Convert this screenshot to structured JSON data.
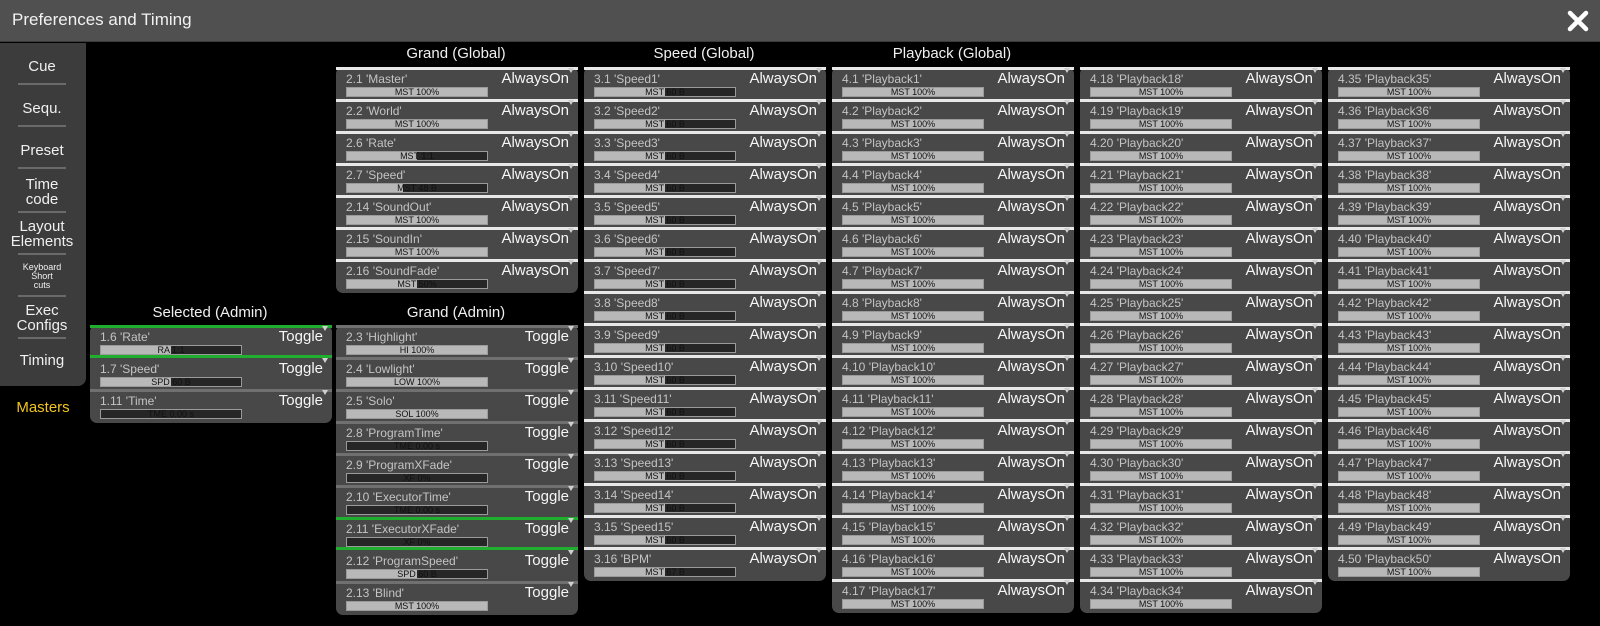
{
  "window": {
    "title": "Preferences and Timing",
    "close_icon": "close-icon"
  },
  "sidebar": {
    "items": [
      {
        "id": "cue",
        "label": "Cue"
      },
      {
        "id": "sequ",
        "label": "Sequ."
      },
      {
        "id": "preset",
        "label": "Preset"
      },
      {
        "id": "timecode",
        "label": "Time\ncode"
      },
      {
        "id": "layout-elements",
        "label": "Layout\nElements"
      },
      {
        "id": "keyboard-shortcuts",
        "label": "Keyboard\nShort\ncuts"
      },
      {
        "id": "exec-configs",
        "label": "Exec\nConfigs"
      },
      {
        "id": "timing",
        "label": "Timing"
      }
    ],
    "masters_label": "Masters",
    "masters_color": "#f2c51e"
  },
  "colors": {
    "panel": "#484848",
    "separator": "#e8e8e8",
    "active": "#1fae2d",
    "accent": "#f2c51e"
  },
  "groups": [
    {
      "id": "selected-admin",
      "title": "Selected (Admin)",
      "rows": [
        {
          "name": "1.6 'Rate'",
          "bar": "RA 1:1",
          "fill": 0.5,
          "value": "Toggle",
          "sep": "green",
          "active": true
        },
        {
          "name": "1.7 'Speed'",
          "bar": "SPD 60 B",
          "fill": 0.5,
          "value": "Toggle",
          "sep": "none"
        },
        {
          "name": "1.11 'Time'",
          "bar": "TME 0.00 s",
          "fill": 0.0,
          "value": "Toggle",
          "sep": "grey"
        }
      ]
    },
    {
      "id": "grand-global",
      "title": "Grand (Global)",
      "rows": [
        {
          "name": "2.1 'Master'",
          "bar": "MST 100%",
          "fill": 1.0,
          "value": "AlwaysOn",
          "sep": "white"
        },
        {
          "name": "2.2 'World'",
          "bar": "MST 100%",
          "fill": 1.0,
          "value": "AlwaysOn",
          "sep": "white"
        },
        {
          "name": "2.6 'Rate'",
          "bar": "MST 1:1",
          "fill": 0.5,
          "value": "AlwaysOn",
          "sep": "white"
        },
        {
          "name": "2.7 'Speed'",
          "bar": "MST 48 B",
          "fill": 0.4,
          "value": "AlwaysOn",
          "sep": "white"
        },
        {
          "name": "2.14 'SoundOut'",
          "bar": "MST 100%",
          "fill": 1.0,
          "value": "AlwaysOn",
          "sep": "white"
        },
        {
          "name": "2.15 'SoundIn'",
          "bar": "MST 100%",
          "fill": 1.0,
          "value": "AlwaysOn",
          "sep": "white"
        },
        {
          "name": "2.16 'SoundFade'",
          "bar": "MST 50%",
          "fill": 0.5,
          "value": "AlwaysOn",
          "sep": "white"
        }
      ]
    },
    {
      "id": "grand-admin",
      "title": "Grand (Admin)",
      "rows": [
        {
          "name": "2.3 'Highlight'",
          "bar": "HI 100%",
          "fill": 1.0,
          "value": "Toggle",
          "sep": "grey"
        },
        {
          "name": "2.4 'Lowlight'",
          "bar": "LOW 100%",
          "fill": 1.0,
          "value": "Toggle",
          "sep": "grey"
        },
        {
          "name": "2.5 'Solo'",
          "bar": "SOL 100%",
          "fill": 1.0,
          "value": "Toggle",
          "sep": "grey"
        },
        {
          "name": "2.8 'ProgramTime'",
          "bar": "TME 0.00 s",
          "fill": 0.0,
          "value": "Toggle",
          "sep": "grey"
        },
        {
          "name": "2.9 'ProgramXFade'",
          "bar": "XF 0%",
          "fill": 0.0,
          "value": "Toggle",
          "sep": "grey"
        },
        {
          "name": "2.10 'ExecutorTime'",
          "bar": "TME 0.00 s",
          "fill": 0.0,
          "value": "Toggle",
          "sep": "grey"
        },
        {
          "name": "2.11 'ExecutorXFade'",
          "bar": "XF 0%",
          "fill": 0.0,
          "value": "Toggle",
          "sep": "green",
          "active": true
        },
        {
          "name": "2.12 'ProgramSpeed'",
          "bar": "SPD 60 B",
          "fill": 0.5,
          "value": "Toggle",
          "sep": "none"
        },
        {
          "name": "2.13 'Blind'",
          "bar": "MST 100%",
          "fill": 1.0,
          "value": "Toggle",
          "sep": "grey"
        }
      ]
    },
    {
      "id": "speed-global",
      "title": "Speed (Global)",
      "rows": [
        {
          "name": "3.1 'Speed1'",
          "bar": "MST 60 B",
          "fill": 0.5,
          "value": "AlwaysOn",
          "sep": "white"
        },
        {
          "name": "3.2 'Speed2'",
          "bar": "MST 60 B",
          "fill": 0.5,
          "value": "AlwaysOn",
          "sep": "white"
        },
        {
          "name": "3.3 'Speed3'",
          "bar": "MST 60 B",
          "fill": 0.5,
          "value": "AlwaysOn",
          "sep": "white"
        },
        {
          "name": "3.4 'Speed4'",
          "bar": "MST 60 B",
          "fill": 0.5,
          "value": "AlwaysOn",
          "sep": "white"
        },
        {
          "name": "3.5 'Speed5'",
          "bar": "MST 60 B",
          "fill": 0.5,
          "value": "AlwaysOn",
          "sep": "white"
        },
        {
          "name": "3.6 'Speed6'",
          "bar": "MST 60 B",
          "fill": 0.5,
          "value": "AlwaysOn",
          "sep": "white"
        },
        {
          "name": "3.7 'Speed7'",
          "bar": "MST 60 B",
          "fill": 0.5,
          "value": "AlwaysOn",
          "sep": "white"
        },
        {
          "name": "3.8 'Speed8'",
          "bar": "MST 60 B",
          "fill": 0.5,
          "value": "AlwaysOn",
          "sep": "white"
        },
        {
          "name": "3.9 'Speed9'",
          "bar": "MST 60 B",
          "fill": 0.5,
          "value": "AlwaysOn",
          "sep": "white"
        },
        {
          "name": "3.10 'Speed10'",
          "bar": "MST 60 B",
          "fill": 0.5,
          "value": "AlwaysOn",
          "sep": "white"
        },
        {
          "name": "3.11 'Speed11'",
          "bar": "MST 60 B",
          "fill": 0.5,
          "value": "AlwaysOn",
          "sep": "white"
        },
        {
          "name": "3.12 'Speed12'",
          "bar": "MST 60 B",
          "fill": 0.5,
          "value": "AlwaysOn",
          "sep": "white"
        },
        {
          "name": "3.13 'Speed13'",
          "bar": "MST 60 B",
          "fill": 0.5,
          "value": "AlwaysOn",
          "sep": "white"
        },
        {
          "name": "3.14 'Speed14'",
          "bar": "MST 60 B",
          "fill": 0.5,
          "value": "AlwaysOn",
          "sep": "white"
        },
        {
          "name": "3.15 'Speed15'",
          "bar": "MST 60 B",
          "fill": 0.5,
          "value": "AlwaysOn",
          "sep": "white"
        },
        {
          "name": "3.16 'BPM'",
          "bar": "MST 67 B",
          "fill": 0.5,
          "value": "AlwaysOn",
          "sep": "white"
        }
      ]
    },
    {
      "id": "playback-global-1",
      "title": "Playback (Global)",
      "rows": [
        {
          "name": "4.1 'Playback1'",
          "bar": "MST 100%",
          "fill": 1.0,
          "value": "AlwaysOn",
          "sep": "white"
        },
        {
          "name": "4.2 'Playback2'",
          "bar": "MST 100%",
          "fill": 1.0,
          "value": "AlwaysOn",
          "sep": "white"
        },
        {
          "name": "4.3 'Playback3'",
          "bar": "MST 100%",
          "fill": 1.0,
          "value": "AlwaysOn",
          "sep": "white"
        },
        {
          "name": "4.4 'Playback4'",
          "bar": "MST 100%",
          "fill": 1.0,
          "value": "AlwaysOn",
          "sep": "white"
        },
        {
          "name": "4.5 'Playback5'",
          "bar": "MST 100%",
          "fill": 1.0,
          "value": "AlwaysOn",
          "sep": "white"
        },
        {
          "name": "4.6 'Playback6'",
          "bar": "MST 100%",
          "fill": 1.0,
          "value": "AlwaysOn",
          "sep": "white"
        },
        {
          "name": "4.7 'Playback7'",
          "bar": "MST 100%",
          "fill": 1.0,
          "value": "AlwaysOn",
          "sep": "white"
        },
        {
          "name": "4.8 'Playback8'",
          "bar": "MST 100%",
          "fill": 1.0,
          "value": "AlwaysOn",
          "sep": "white"
        },
        {
          "name": "4.9 'Playback9'",
          "bar": "MST 100%",
          "fill": 1.0,
          "value": "AlwaysOn",
          "sep": "white"
        },
        {
          "name": "4.10 'Playback10'",
          "bar": "MST 100%",
          "fill": 1.0,
          "value": "AlwaysOn",
          "sep": "white"
        },
        {
          "name": "4.11 'Playback11'",
          "bar": "MST 100%",
          "fill": 1.0,
          "value": "AlwaysOn",
          "sep": "white"
        },
        {
          "name": "4.12 'Playback12'",
          "bar": "MST 100%",
          "fill": 1.0,
          "value": "AlwaysOn",
          "sep": "white"
        },
        {
          "name": "4.13 'Playback13'",
          "bar": "MST 100%",
          "fill": 1.0,
          "value": "AlwaysOn",
          "sep": "white"
        },
        {
          "name": "4.14 'Playback14'",
          "bar": "MST 100%",
          "fill": 1.0,
          "value": "AlwaysOn",
          "sep": "white"
        },
        {
          "name": "4.15 'Playback15'",
          "bar": "MST 100%",
          "fill": 1.0,
          "value": "AlwaysOn",
          "sep": "white"
        },
        {
          "name": "4.16 'Playback16'",
          "bar": "MST 100%",
          "fill": 1.0,
          "value": "AlwaysOn",
          "sep": "white"
        },
        {
          "name": "4.17 'Playback17'",
          "bar": "MST 100%",
          "fill": 1.0,
          "value": "AlwaysOn",
          "sep": "white"
        }
      ]
    },
    {
      "id": "playback-global-2",
      "title": "",
      "rows": [
        {
          "name": "4.18 'Playback18'",
          "bar": "MST 100%",
          "fill": 1.0,
          "value": "AlwaysOn",
          "sep": "white"
        },
        {
          "name": "4.19 'Playback19'",
          "bar": "MST 100%",
          "fill": 1.0,
          "value": "AlwaysOn",
          "sep": "white"
        },
        {
          "name": "4.20 'Playback20'",
          "bar": "MST 100%",
          "fill": 1.0,
          "value": "AlwaysOn",
          "sep": "white"
        },
        {
          "name": "4.21 'Playback21'",
          "bar": "MST 100%",
          "fill": 1.0,
          "value": "AlwaysOn",
          "sep": "white"
        },
        {
          "name": "4.22 'Playback22'",
          "bar": "MST 100%",
          "fill": 1.0,
          "value": "AlwaysOn",
          "sep": "white"
        },
        {
          "name": "4.23 'Playback23'",
          "bar": "MST 100%",
          "fill": 1.0,
          "value": "AlwaysOn",
          "sep": "white"
        },
        {
          "name": "4.24 'Playback24'",
          "bar": "MST 100%",
          "fill": 1.0,
          "value": "AlwaysOn",
          "sep": "white"
        },
        {
          "name": "4.25 'Playback25'",
          "bar": "MST 100%",
          "fill": 1.0,
          "value": "AlwaysOn",
          "sep": "white"
        },
        {
          "name": "4.26 'Playback26'",
          "bar": "MST 100%",
          "fill": 1.0,
          "value": "AlwaysOn",
          "sep": "white"
        },
        {
          "name": "4.27 'Playback27'",
          "bar": "MST 100%",
          "fill": 1.0,
          "value": "AlwaysOn",
          "sep": "white"
        },
        {
          "name": "4.28 'Playback28'",
          "bar": "MST 100%",
          "fill": 1.0,
          "value": "AlwaysOn",
          "sep": "white"
        },
        {
          "name": "4.29 'Playback29'",
          "bar": "MST 100%",
          "fill": 1.0,
          "value": "AlwaysOn",
          "sep": "white"
        },
        {
          "name": "4.30 'Playback30'",
          "bar": "MST 100%",
          "fill": 1.0,
          "value": "AlwaysOn",
          "sep": "white"
        },
        {
          "name": "4.31 'Playback31'",
          "bar": "MST 100%",
          "fill": 1.0,
          "value": "AlwaysOn",
          "sep": "white"
        },
        {
          "name": "4.32 'Playback32'",
          "bar": "MST 100%",
          "fill": 1.0,
          "value": "AlwaysOn",
          "sep": "white"
        },
        {
          "name": "4.33 'Playback33'",
          "bar": "MST 100%",
          "fill": 1.0,
          "value": "AlwaysOn",
          "sep": "white"
        },
        {
          "name": "4.34 'Playback34'",
          "bar": "MST 100%",
          "fill": 1.0,
          "value": "AlwaysOn",
          "sep": "white"
        }
      ]
    },
    {
      "id": "playback-global-3",
      "title": "",
      "rows": [
        {
          "name": "4.35 'Playback35'",
          "bar": "MST 100%",
          "fill": 1.0,
          "value": "AlwaysOn",
          "sep": "white"
        },
        {
          "name": "4.36 'Playback36'",
          "bar": "MST 100%",
          "fill": 1.0,
          "value": "AlwaysOn",
          "sep": "white"
        },
        {
          "name": "4.37 'Playback37'",
          "bar": "MST 100%",
          "fill": 1.0,
          "value": "AlwaysOn",
          "sep": "white"
        },
        {
          "name": "4.38 'Playback38'",
          "bar": "MST 100%",
          "fill": 1.0,
          "value": "AlwaysOn",
          "sep": "white"
        },
        {
          "name": "4.39 'Playback39'",
          "bar": "MST 100%",
          "fill": 1.0,
          "value": "AlwaysOn",
          "sep": "white"
        },
        {
          "name": "4.40 'Playback40'",
          "bar": "MST 100%",
          "fill": 1.0,
          "value": "AlwaysOn",
          "sep": "white"
        },
        {
          "name": "4.41 'Playback41'",
          "bar": "MST 100%",
          "fill": 1.0,
          "value": "AlwaysOn",
          "sep": "white"
        },
        {
          "name": "4.42 'Playback42'",
          "bar": "MST 100%",
          "fill": 1.0,
          "value": "AlwaysOn",
          "sep": "white"
        },
        {
          "name": "4.43 'Playback43'",
          "bar": "MST 100%",
          "fill": 1.0,
          "value": "AlwaysOn",
          "sep": "white"
        },
        {
          "name": "4.44 'Playback44'",
          "bar": "MST 100%",
          "fill": 1.0,
          "value": "AlwaysOn",
          "sep": "white"
        },
        {
          "name": "4.45 'Playback45'",
          "bar": "MST 100%",
          "fill": 1.0,
          "value": "AlwaysOn",
          "sep": "white"
        },
        {
          "name": "4.46 'Playback46'",
          "bar": "MST 100%",
          "fill": 1.0,
          "value": "AlwaysOn",
          "sep": "white"
        },
        {
          "name": "4.47 'Playback47'",
          "bar": "MST 100%",
          "fill": 1.0,
          "value": "AlwaysOn",
          "sep": "white"
        },
        {
          "name": "4.48 'Playback48'",
          "bar": "MST 100%",
          "fill": 1.0,
          "value": "AlwaysOn",
          "sep": "white"
        },
        {
          "name": "4.49 'Playback49'",
          "bar": "MST 100%",
          "fill": 1.0,
          "value": "AlwaysOn",
          "sep": "white"
        },
        {
          "name": "4.50 'Playback50'",
          "bar": "MST 100%",
          "fill": 1.0,
          "value": "AlwaysOn",
          "sep": "white"
        }
      ]
    }
  ]
}
